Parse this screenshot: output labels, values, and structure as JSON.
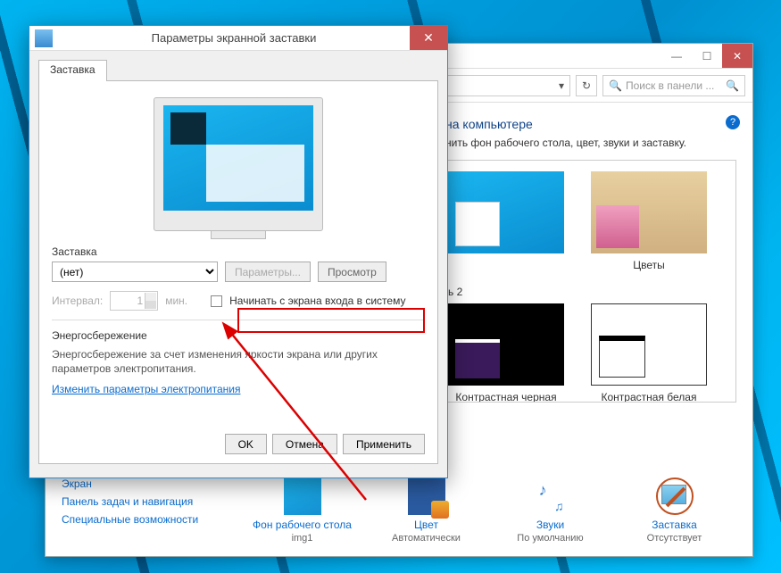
{
  "dialog": {
    "title": "Параметры экранной заставки",
    "tab": "Заставка",
    "group_label": "Заставка",
    "saver_select_value": "(нет)",
    "params_btn": "Параметры...",
    "preview_btn": "Просмотр",
    "interval_label": "Интервал:",
    "interval_value": "1",
    "interval_unit": "мин.",
    "checkbox_label": "Начинать с экрана входа в систему",
    "energy_title": "Энергосбережение",
    "energy_text": "Энергосбережение за счет изменения яркости экрана или других параметров электропитания.",
    "energy_link": "Изменить параметры электропитания",
    "ok": "OK",
    "cancel": "Отмена",
    "apply": "Применить"
  },
  "cp": {
    "search_placeholder": "Поиск в панели ...",
    "heading_fragment": "на компьютере",
    "subtitle_fragment": "нить фон рабочего стола, цвет, звуки и заставку.",
    "theme_colors": "Цветы",
    "hc_label_fragment": "ь 2",
    "theme_hc_black": "Контрастная черная",
    "theme_hc_white": "Контрастная белая",
    "left_links": [
      "Экран",
      "Панель задач и навигация",
      "Специальные возможности"
    ],
    "settings": {
      "bg": {
        "label": "Фон рабочего стола",
        "value": "img1"
      },
      "color": {
        "label": "Цвет",
        "value": "Автоматически"
      },
      "sound": {
        "label": "Звуки",
        "value": "По умолчанию"
      },
      "saver": {
        "label": "Заставка",
        "value": "Отсутствует"
      }
    }
  }
}
